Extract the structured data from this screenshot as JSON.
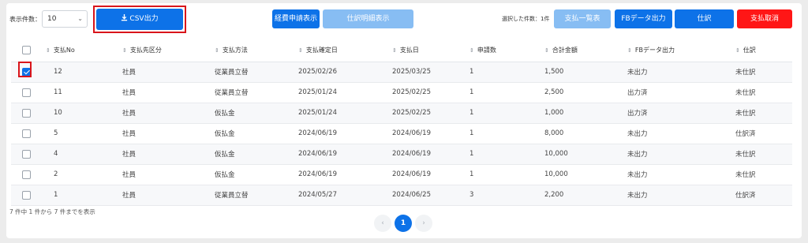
{
  "toolbar": {
    "display_count_label": "表示件数：",
    "display_count_value": "10",
    "csv_button": "CSV出力",
    "expense_button": "経費申請表示",
    "journal_detail_button": "仕訳明細表示",
    "selected_count_label": "選択した件数：1件",
    "payment_list_button": "支払一覧表",
    "fb_button": "FBデータ出力",
    "journal_button": "仕訳",
    "cancel_payment_button": "支払取消"
  },
  "table": {
    "headers": [
      "支払No",
      "支払先区分",
      "支払方法",
      "支払確定日",
      "支払日",
      "申請数",
      "合計金額",
      "FBデータ出力",
      "仕訳"
    ],
    "rows": [
      {
        "checked": true,
        "no": "12",
        "payee": "社員",
        "method": "従業員立替",
        "confirm_date": "2025/02/26",
        "pay_date": "2025/03/25",
        "count": "1",
        "amount": "1,500",
        "fb": "未出力",
        "journal": "未仕訳"
      },
      {
        "checked": false,
        "no": "11",
        "payee": "社員",
        "method": "従業員立替",
        "confirm_date": "2025/01/24",
        "pay_date": "2025/02/25",
        "count": "1",
        "amount": "2,500",
        "fb": "出力済",
        "journal": "未仕訳"
      },
      {
        "checked": false,
        "no": "10",
        "payee": "社員",
        "method": "仮払金",
        "confirm_date": "2025/01/24",
        "pay_date": "2025/02/25",
        "count": "1",
        "amount": "1,000",
        "fb": "出力済",
        "journal": "未仕訳"
      },
      {
        "checked": false,
        "no": "5",
        "payee": "社員",
        "method": "仮払金",
        "confirm_date": "2024/06/19",
        "pay_date": "2024/06/19",
        "count": "1",
        "amount": "8,000",
        "fb": "未出力",
        "journal": "仕訳済"
      },
      {
        "checked": false,
        "no": "4",
        "payee": "社員",
        "method": "仮払金",
        "confirm_date": "2024/06/19",
        "pay_date": "2024/06/19",
        "count": "1",
        "amount": "10,000",
        "fb": "未出力",
        "journal": "未仕訳"
      },
      {
        "checked": false,
        "no": "2",
        "payee": "社員",
        "method": "仮払金",
        "confirm_date": "2024/06/19",
        "pay_date": "2024/06/19",
        "count": "1",
        "amount": "10,000",
        "fb": "未出力",
        "journal": "未仕訳"
      },
      {
        "checked": false,
        "no": "1",
        "payee": "社員",
        "method": "従業員立替",
        "confirm_date": "2024/05/27",
        "pay_date": "2024/06/25",
        "count": "3",
        "amount": "2,200",
        "fb": "未出力",
        "journal": "仕訳済"
      }
    ]
  },
  "footer": {
    "summary": "7 件中 1 件から 7 件までを表示",
    "prev": "‹",
    "current_page": "1",
    "next": "›"
  },
  "colors": {
    "primary": "#0d72e8",
    "disabled": "#87bdf3",
    "danger": "#ff1616",
    "highlight": "#d9151b"
  }
}
